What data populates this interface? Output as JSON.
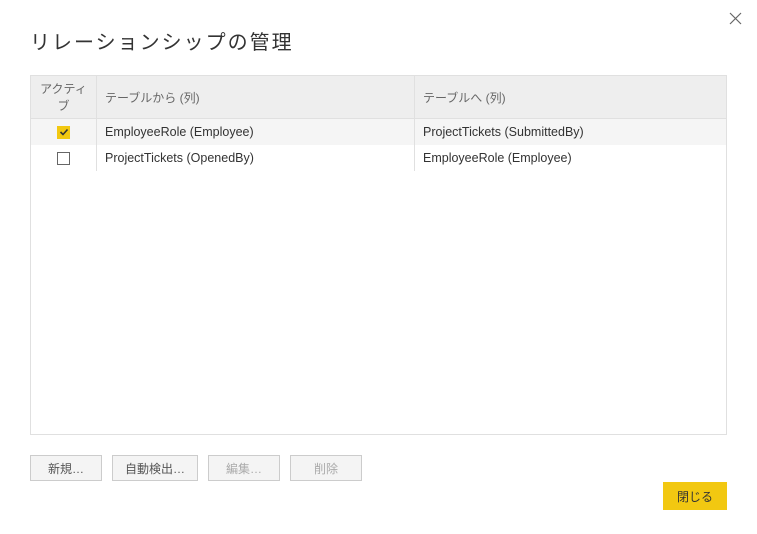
{
  "dialog": {
    "title": "リレーションシップの管理"
  },
  "table": {
    "headers": {
      "active": "アクティブ",
      "from": "テーブルから (列)",
      "to": "テーブルへ (列)"
    },
    "rows": [
      {
        "active": true,
        "selected": true,
        "from": "EmployeeRole (Employee)",
        "to": "ProjectTickets (SubmittedBy)"
      },
      {
        "active": false,
        "selected": false,
        "from": "ProjectTickets (OpenedBy)",
        "to": "EmployeeRole (Employee)"
      }
    ]
  },
  "buttons": {
    "new": "新規…",
    "autodetect": "自動検出…",
    "edit": "編集…",
    "delete": "削除",
    "close": "閉じる"
  }
}
